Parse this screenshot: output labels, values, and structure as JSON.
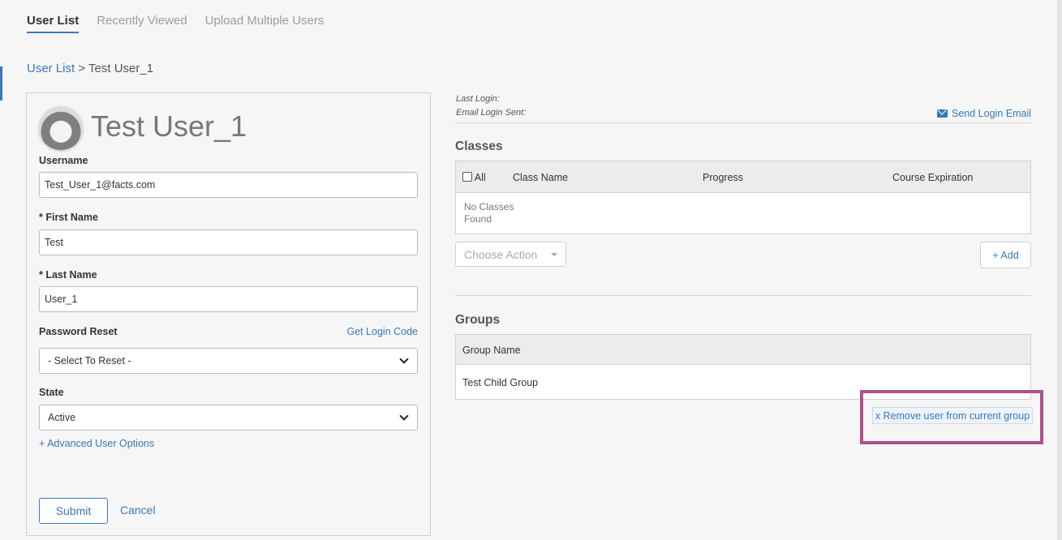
{
  "tabs": [
    {
      "label": "User List",
      "active": true
    },
    {
      "label": "Recently Viewed",
      "active": false
    },
    {
      "label": "Upload Multiple Users",
      "active": false
    }
  ],
  "breadcrumb": {
    "link": "User List",
    "separator": ">",
    "current": "Test User_1"
  },
  "user": {
    "display_name": "Test User_1",
    "username_label": "Username",
    "username_value": "Test_User_1@facts.com",
    "first_name_label": "* First Name",
    "first_name_value": "Test",
    "last_name_label": "* Last Name",
    "last_name_value": "User_1",
    "password_reset_label": "Password Reset",
    "get_login_code": "Get Login Code",
    "password_reset_select": "- Select To Reset -",
    "state_label": "State",
    "state_value": "Active",
    "advanced_options": "+ Advanced User Options",
    "submit": "Submit",
    "cancel": "Cancel"
  },
  "login_info": {
    "last_login_label": "Last Login:",
    "email_login_sent_label": "Email Login Sent:",
    "send_login_email": "Send Login Email"
  },
  "classes": {
    "title": "Classes",
    "all_label": "All",
    "columns": [
      "Class Name",
      "Progress",
      "Course Expiration"
    ],
    "empty_text": "No Classes Found",
    "choose_action": "Choose Action",
    "add_button": "+ Add"
  },
  "groups": {
    "title": "Groups",
    "column": "Group Name",
    "rows": [
      "Test Child Group"
    ],
    "remove_link": "x Remove user from current group"
  },
  "colors": {
    "accent": "#3a78b8",
    "highlight": "#b0508e",
    "background": "#f6f6f6"
  }
}
